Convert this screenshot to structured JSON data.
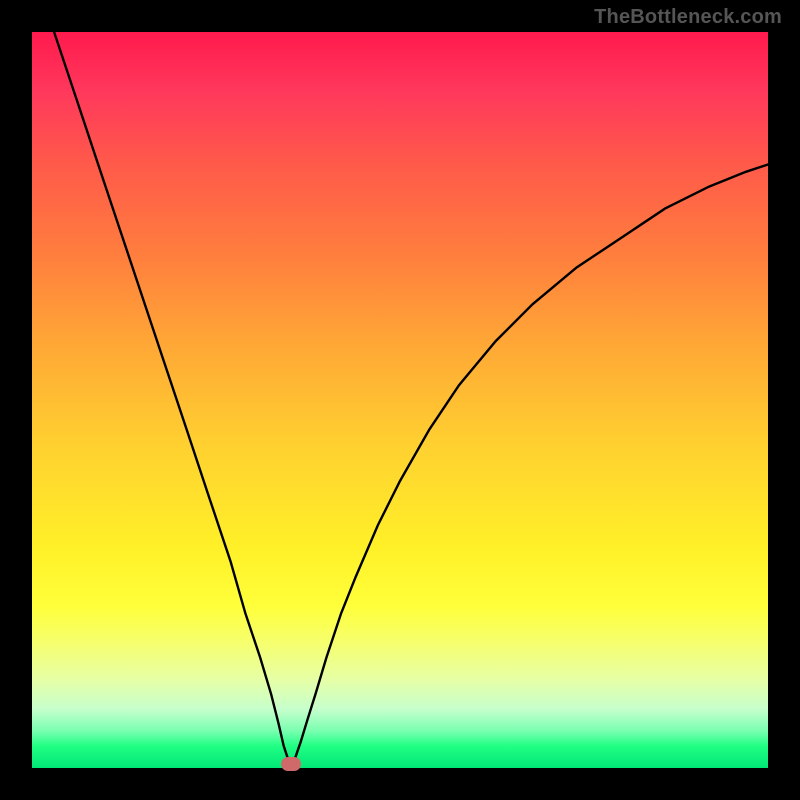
{
  "watermark": "TheBottleneck.com",
  "chart_data": {
    "type": "line",
    "title": "",
    "xlabel": "",
    "ylabel": "",
    "xlim": [
      0,
      100
    ],
    "ylim": [
      0,
      100
    ],
    "series": [
      {
        "name": "curve",
        "x": [
          3,
          6,
          9,
          12,
          15,
          18,
          21,
          24,
          27,
          29,
          31,
          32.5,
          33.5,
          34.2,
          34.8,
          35.2,
          35.8,
          36.5,
          37.4,
          38.5,
          40,
          42,
          44,
          47,
          50,
          54,
          58,
          63,
          68,
          74,
          80,
          86,
          92,
          97,
          100
        ],
        "y": [
          100,
          91,
          82,
          73,
          64,
          55,
          46,
          37,
          28,
          21,
          15,
          10,
          6,
          3,
          1.2,
          0.5,
          1.5,
          3.5,
          6.5,
          10,
          15,
          21,
          26,
          33,
          39,
          46,
          52,
          58,
          63,
          68,
          72,
          76,
          79,
          81,
          82
        ]
      }
    ],
    "marker": {
      "x": 35.2,
      "y": 0.5
    },
    "background": "red-green-gradient"
  }
}
